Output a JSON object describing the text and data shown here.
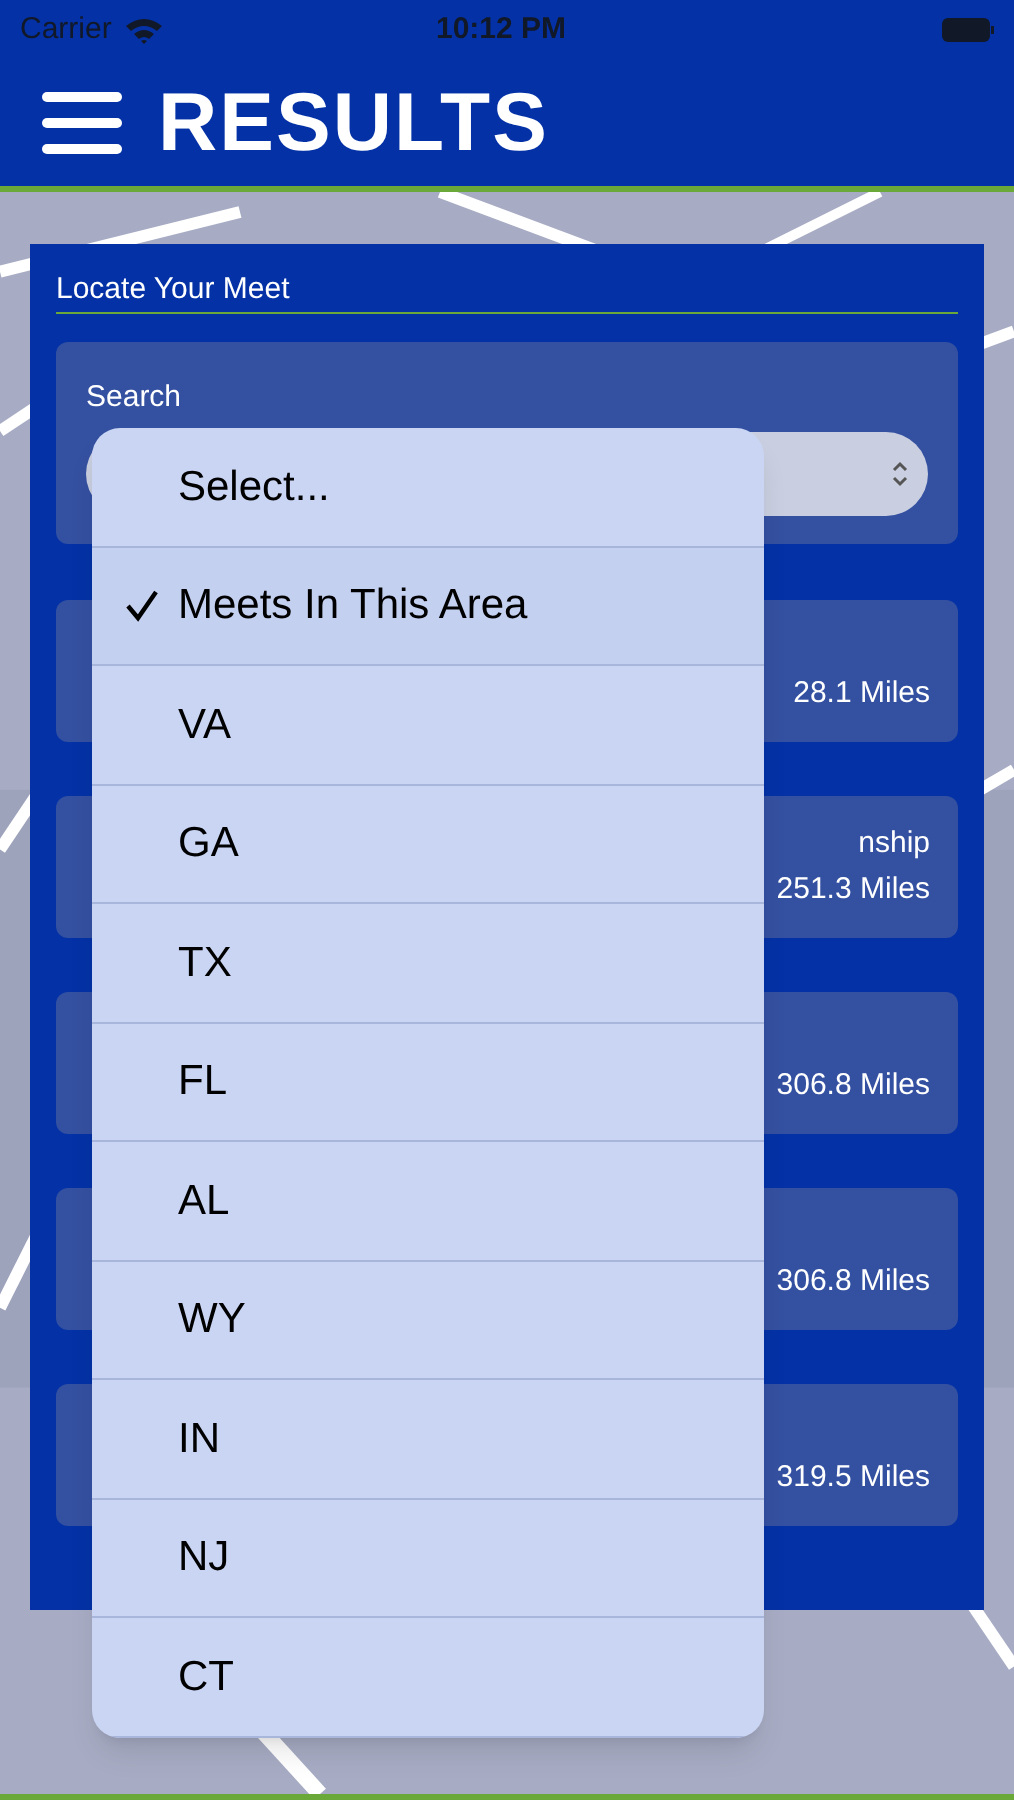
{
  "status_bar": {
    "carrier": "Carrier",
    "time": "10:12 PM"
  },
  "header": {
    "title": "RESULTS"
  },
  "panel": {
    "title": "Locate Your Meet",
    "search": {
      "label": "Search"
    },
    "meets": [
      {
        "distance": "28.1 Miles"
      },
      {
        "title": "nship",
        "distance": "251.3 Miles"
      },
      {
        "distance": "306.8 Miles"
      },
      {
        "distance": "306.8 Miles"
      },
      {
        "distance": "319.5 Miles"
      }
    ]
  },
  "dropdown": {
    "options": [
      {
        "label": "Select...",
        "selected": false
      },
      {
        "label": "Meets In This Area",
        "selected": true
      },
      {
        "label": "VA",
        "selected": false
      },
      {
        "label": "GA",
        "selected": false
      },
      {
        "label": "TX",
        "selected": false
      },
      {
        "label": "FL",
        "selected": false
      },
      {
        "label": "AL",
        "selected": false
      },
      {
        "label": "WY",
        "selected": false
      },
      {
        "label": "IN",
        "selected": false
      },
      {
        "label": "NJ",
        "selected": false
      },
      {
        "label": "CT",
        "selected": false
      }
    ]
  }
}
